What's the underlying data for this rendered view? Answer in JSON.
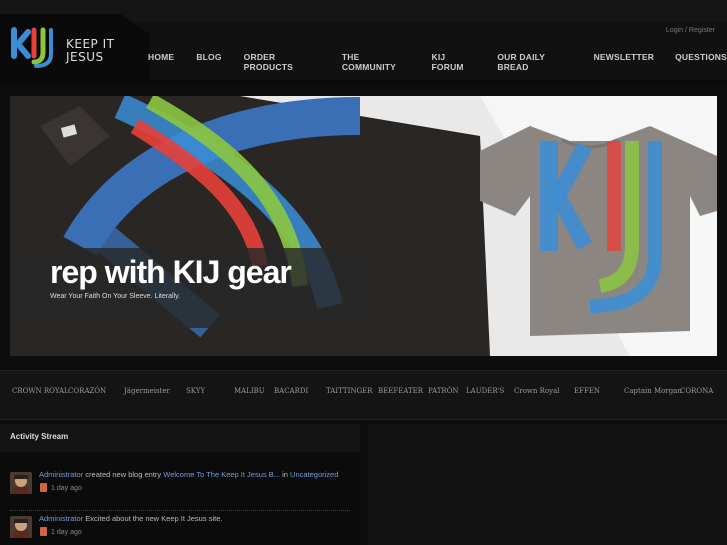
{
  "header": {
    "logo_text_line1": "KEEP IT",
    "logo_text_line2": "JESUS",
    "login": "Login",
    "separator": "/",
    "register": "Register",
    "nav": [
      "HOME",
      "BLOG",
      "ORDER PRODUCTS",
      "THE COMMUNITY",
      "KIJ FORUM",
      "OUR DAILY BREAD",
      "NEWSLETTER",
      "QUESTIONS"
    ]
  },
  "hero": {
    "title": "rep with KIJ gear",
    "subtitle": "Wear Your Faith On Your Sleeve. Literally."
  },
  "brands": [
    "CROWN ROYAL",
    "CORAZÓN",
    "Jägermeister",
    "SKYY",
    "MALIBU",
    "BACARDI",
    "TAITTINGER",
    "BEEFEATER",
    "PATRÓN",
    "LAUDER'S",
    "Crown Royal",
    "EFFEN",
    "Captain Morgan",
    "CORONA"
  ],
  "activity": {
    "title": "Activity Stream",
    "items": [
      {
        "user": "Administrator",
        "text_before": "created new blog entry",
        "link": "Welcome To The Keep It Jesus B...",
        "text_mid": "in",
        "category": "Uncategorized",
        "time": "1 day ago"
      },
      {
        "user": "Administrator",
        "text_before": "Excited about the new Keep It Jesus site.",
        "time": "1 day ago"
      }
    ]
  },
  "colors": {
    "blue": "#3a8ed8",
    "green": "#8cc63f",
    "red": "#e8403a",
    "link": "#6f9fd8"
  }
}
